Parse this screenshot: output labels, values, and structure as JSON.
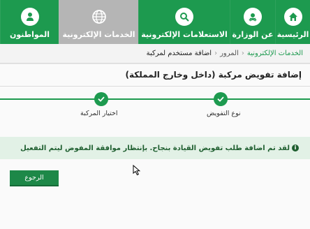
{
  "nav": {
    "items": [
      {
        "label": "الرئيسية",
        "icon": "home-icon"
      },
      {
        "label": "عن الوزارة",
        "icon": "emblem-icon"
      },
      {
        "label": "الاستعلامات الإلكترونية",
        "icon": "inquiry-icon"
      },
      {
        "label": "الخدمات الإلكترونية",
        "icon": "globe-icon",
        "active": true
      },
      {
        "label": "المواطنون",
        "icon": "citizens-icon"
      }
    ]
  },
  "breadcrumb": {
    "items": [
      "الخدمات الإلكترونية",
      "المرور",
      "اضافة مستخدم لمركبة"
    ]
  },
  "page": {
    "title": "إضافة تفويض مركبة (داخل وخارج المملكة)"
  },
  "stepper": {
    "steps": [
      {
        "label": "نوع التفويض",
        "done": true
      },
      {
        "label": "اختيار المركبة",
        "done": true
      }
    ]
  },
  "alert": {
    "message": "لقد تم اضافة طلب تفويض القيادة بنجاح. بإنتظار موافقة المفوض ليتم التفعيل"
  },
  "actions": {
    "back_label": "الرجوع"
  },
  "colors": {
    "brand_green": "#1d9a4f",
    "active_tab": "#b5b5b5",
    "alert_bg": "#e2f1e6",
    "alert_text": "#1e5e2f"
  }
}
